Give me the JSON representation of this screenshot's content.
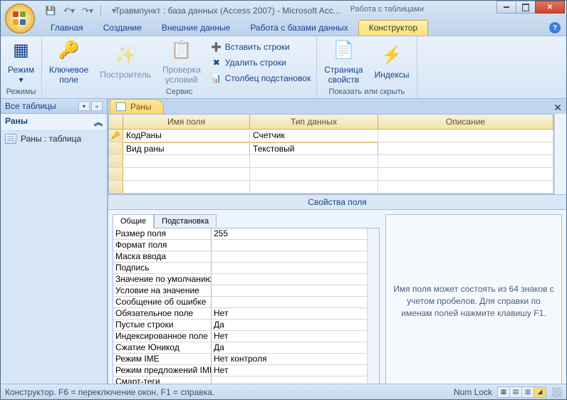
{
  "title": "Травмпункт : база данных (Access 2007) - Microsoft Acc...",
  "context_tab_group": "Работа с таблицами",
  "ribbon_tabs": [
    "Главная",
    "Создание",
    "Внешние данные",
    "Работа с базами данных",
    "Конструктор"
  ],
  "active_tab_index": 4,
  "ribbon": {
    "groups": [
      {
        "label": "Режимы",
        "items": [
          {
            "label": "Режим"
          }
        ]
      },
      {
        "label": "Сервис",
        "items": [
          {
            "label": "Ключевое\nполе"
          },
          {
            "label": "Построитель"
          },
          {
            "label": "Проверка\nусловий"
          },
          {
            "label": "Вставить строки"
          },
          {
            "label": "Удалить строки"
          },
          {
            "label": "Столбец подстановок"
          }
        ]
      },
      {
        "label": "Показать или скрыть",
        "items": [
          {
            "label": "Страница\nсвойств"
          },
          {
            "label": "Индексы"
          }
        ]
      }
    ]
  },
  "nav": {
    "header": "Все таблицы",
    "group": "Раны",
    "items": [
      "Раны : таблица"
    ]
  },
  "doc_tab": "Раны",
  "grid": {
    "headers": {
      "name": "Имя поля",
      "type": "Тип данных",
      "desc": "Описание"
    },
    "rows": [
      {
        "key": true,
        "name": "КодРаны",
        "type": "Счетчик"
      },
      {
        "key": false,
        "name": "Вид раны",
        "type": "Текстовый",
        "selected": true
      }
    ]
  },
  "props_header": "Свойства поля",
  "prop_tabs": [
    "Общие",
    "Подстановка"
  ],
  "props": [
    {
      "name": "Размер поля",
      "value": "255"
    },
    {
      "name": "Формат поля",
      "value": ""
    },
    {
      "name": "Маска ввода",
      "value": ""
    },
    {
      "name": "Подпись",
      "value": ""
    },
    {
      "name": "Значение по умолчанию",
      "value": ""
    },
    {
      "name": "Условие на значение",
      "value": ""
    },
    {
      "name": "Сообщение об ошибке",
      "value": ""
    },
    {
      "name": "Обязательное поле",
      "value": "Нет"
    },
    {
      "name": "Пустые строки",
      "value": "Да"
    },
    {
      "name": "Индексированное поле",
      "value": "Нет"
    },
    {
      "name": "Сжатие Юникод",
      "value": "Да"
    },
    {
      "name": "Режим IME",
      "value": "Нет контроля"
    },
    {
      "name": "Режим предложений IME",
      "value": "Нет"
    },
    {
      "name": "Смарт-теги",
      "value": ""
    }
  ],
  "help_text": "Имя поля может состоять из 64 знаков с учетом пробелов.  Для справки по именам полей нажмите клавишу F1.",
  "status_left": "Конструктор.  F6 = переключение окон.  F1 = справка.",
  "status_right": "Num Lock"
}
